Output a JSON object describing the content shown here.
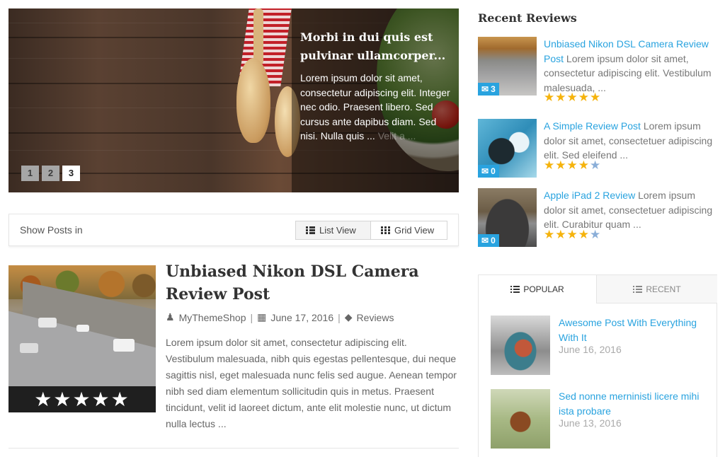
{
  "slider": {
    "title": "Morbi in dui quis est pulvinar ullamcorper...",
    "text": "Lorem ipsum dolor sit amet, consectetur adipiscing elit. Integer nec odio. Praesent libero. Sed cursus ante dapibus diam. Sed nisi. Nulla quis ...",
    "more": "Velit a ...",
    "pages": [
      "1",
      "2",
      "3"
    ],
    "active_page": "3"
  },
  "view_switcher": {
    "label": "Show Posts in",
    "list_label": "List View",
    "grid_label": "Grid View"
  },
  "post": {
    "title": "Unbiased Nikon DSL Camera Review Post",
    "author": "MyThemeShop",
    "date": "June 17, 2016",
    "category": "Reviews",
    "separator": "|",
    "stars": "★★★★★",
    "excerpt": "Lorem ipsum dolor sit amet, consectetur adipiscing elit. Vestibulum malesuada, nibh quis egestas pellentesque, dui neque sagittis nisl, eget malesuada nunc felis sed augue. Aenean tempor nibh sed diam elementum sollicitudin quis in metus. Praesent tincidunt, velit id laoreet dictum, ante elit molestie nunc, ut dictum nulla lectus ..."
  },
  "sidebar": {
    "recent_reviews_title": "Recent Reviews",
    "reviews": [
      {
        "link": "Unbiased Nikon DSL Camera Review Post",
        "text": " Lorem ipsum dolor sit amet, consectetur adipiscing elit. Vestibulum malesuada, ...",
        "comments": "3",
        "rating": 4.5,
        "stars_on": "★★★★★",
        "stars_off": ""
      },
      {
        "link": "A Simple Review Post",
        "text": " Lorem ipsum dolor sit amet, consectetuer adipiscing elit. Sed eleifend ...",
        "comments": "0",
        "rating": 4,
        "stars_on": "★★★★",
        "stars_off": "★"
      },
      {
        "link": "Apple iPad 2 Review",
        "text": " Lorem ipsum dolor sit amet, consectetuer adipiscing elit. Curabitur quam ...",
        "comments": "0",
        "rating": 4,
        "stars_on": "★★★★",
        "stars_off": "★"
      }
    ],
    "tabs": {
      "popular": "Popular",
      "recent": "Recent"
    },
    "popular": [
      {
        "title": "Awesome Post With Everything With It",
        "date": "June 16, 2016"
      },
      {
        "title": "Sed nonne merninisti licere mihi ista probare",
        "date": "June 13, 2016"
      }
    ]
  },
  "colors": {
    "accent": "#29a3df",
    "star": "#f5b30c",
    "star_off": "#8aaed8",
    "text": "#666666",
    "heading": "#333333"
  }
}
